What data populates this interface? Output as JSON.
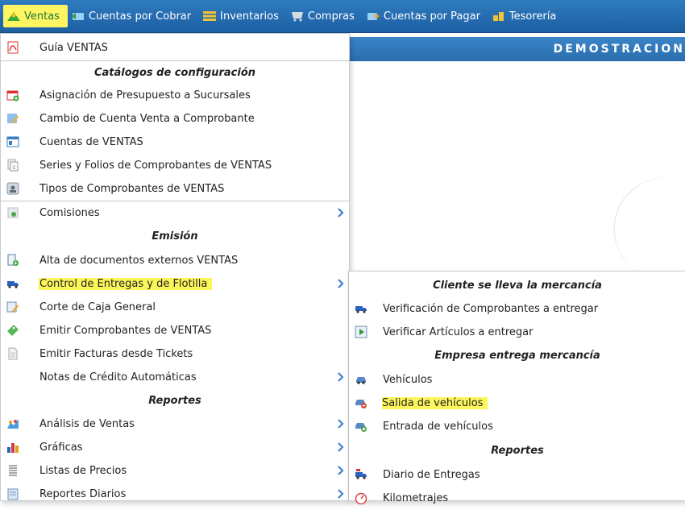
{
  "menubar": {
    "items": [
      {
        "label": "Ventas",
        "icon": "ventas-icon"
      },
      {
        "label": "Cuentas por Cobrar",
        "icon": "cuentas-cobrar-icon"
      },
      {
        "label": "Inventarios",
        "icon": "inventarios-icon"
      },
      {
        "label": "Compras",
        "icon": "compras-icon"
      },
      {
        "label": "Cuentas por Pagar",
        "icon": "cuentas-pagar-icon"
      },
      {
        "label": "Tesorería",
        "icon": "tesoreria-icon"
      }
    ]
  },
  "page": {
    "banner": "DEMOSTRACION"
  },
  "ventas_menu": {
    "guia": "Guía VENTAS",
    "h_catalogos": "Catálogos de configuración",
    "asignacion": "Asignación de Presupuesto a Sucursales",
    "cambio_cuenta": "Cambio de Cuenta Venta a Comprobante",
    "cuentas_ventas": "Cuentas de VENTAS",
    "series_folios": "Series y Folios de Comprobantes de VENTAS",
    "tipos_comprobantes": "Tipos de Comprobantes de VENTAS",
    "comisiones": "Comisiones",
    "h_emision": "Emisión",
    "alta_documentos": "Alta de documentos externos VENTAS",
    "control_entregas": "Control de Entregas y de Flotilla",
    "corte_caja": "Corte de Caja General",
    "emitir_comprobantes": "Emitir Comprobantes de VENTAS",
    "emitir_facturas": "Emitir Facturas desde Tickets",
    "notas_credito": "Notas de Crédito Automáticas",
    "h_reportes": "Reportes",
    "analisis_ventas": "Análisis de Ventas",
    "graficas": "Gráficas",
    "listas_precios": "Listas de Precios",
    "reportes_diarios": "Reportes Diarios"
  },
  "entregas_submenu": {
    "h_cliente": "Cliente se lleva la mercancía",
    "verificacion_comprobantes": "Verificación de Comprobantes a entregar",
    "verificar_articulos": "Verificar Artículos a entregar",
    "h_empresa": "Empresa entrega mercancía",
    "vehiculos": "Vehículos",
    "salida_vehiculos": "Salida de vehículos",
    "entrada_vehiculos": "Entrada de vehículos",
    "h_reportes": "Reportes",
    "diario_entregas": "Diario de Entregas",
    "kilometrajes": "Kilometrajes"
  },
  "colors": {
    "highlight": "#fbf65a",
    "menubar": "#2a6fb2"
  }
}
